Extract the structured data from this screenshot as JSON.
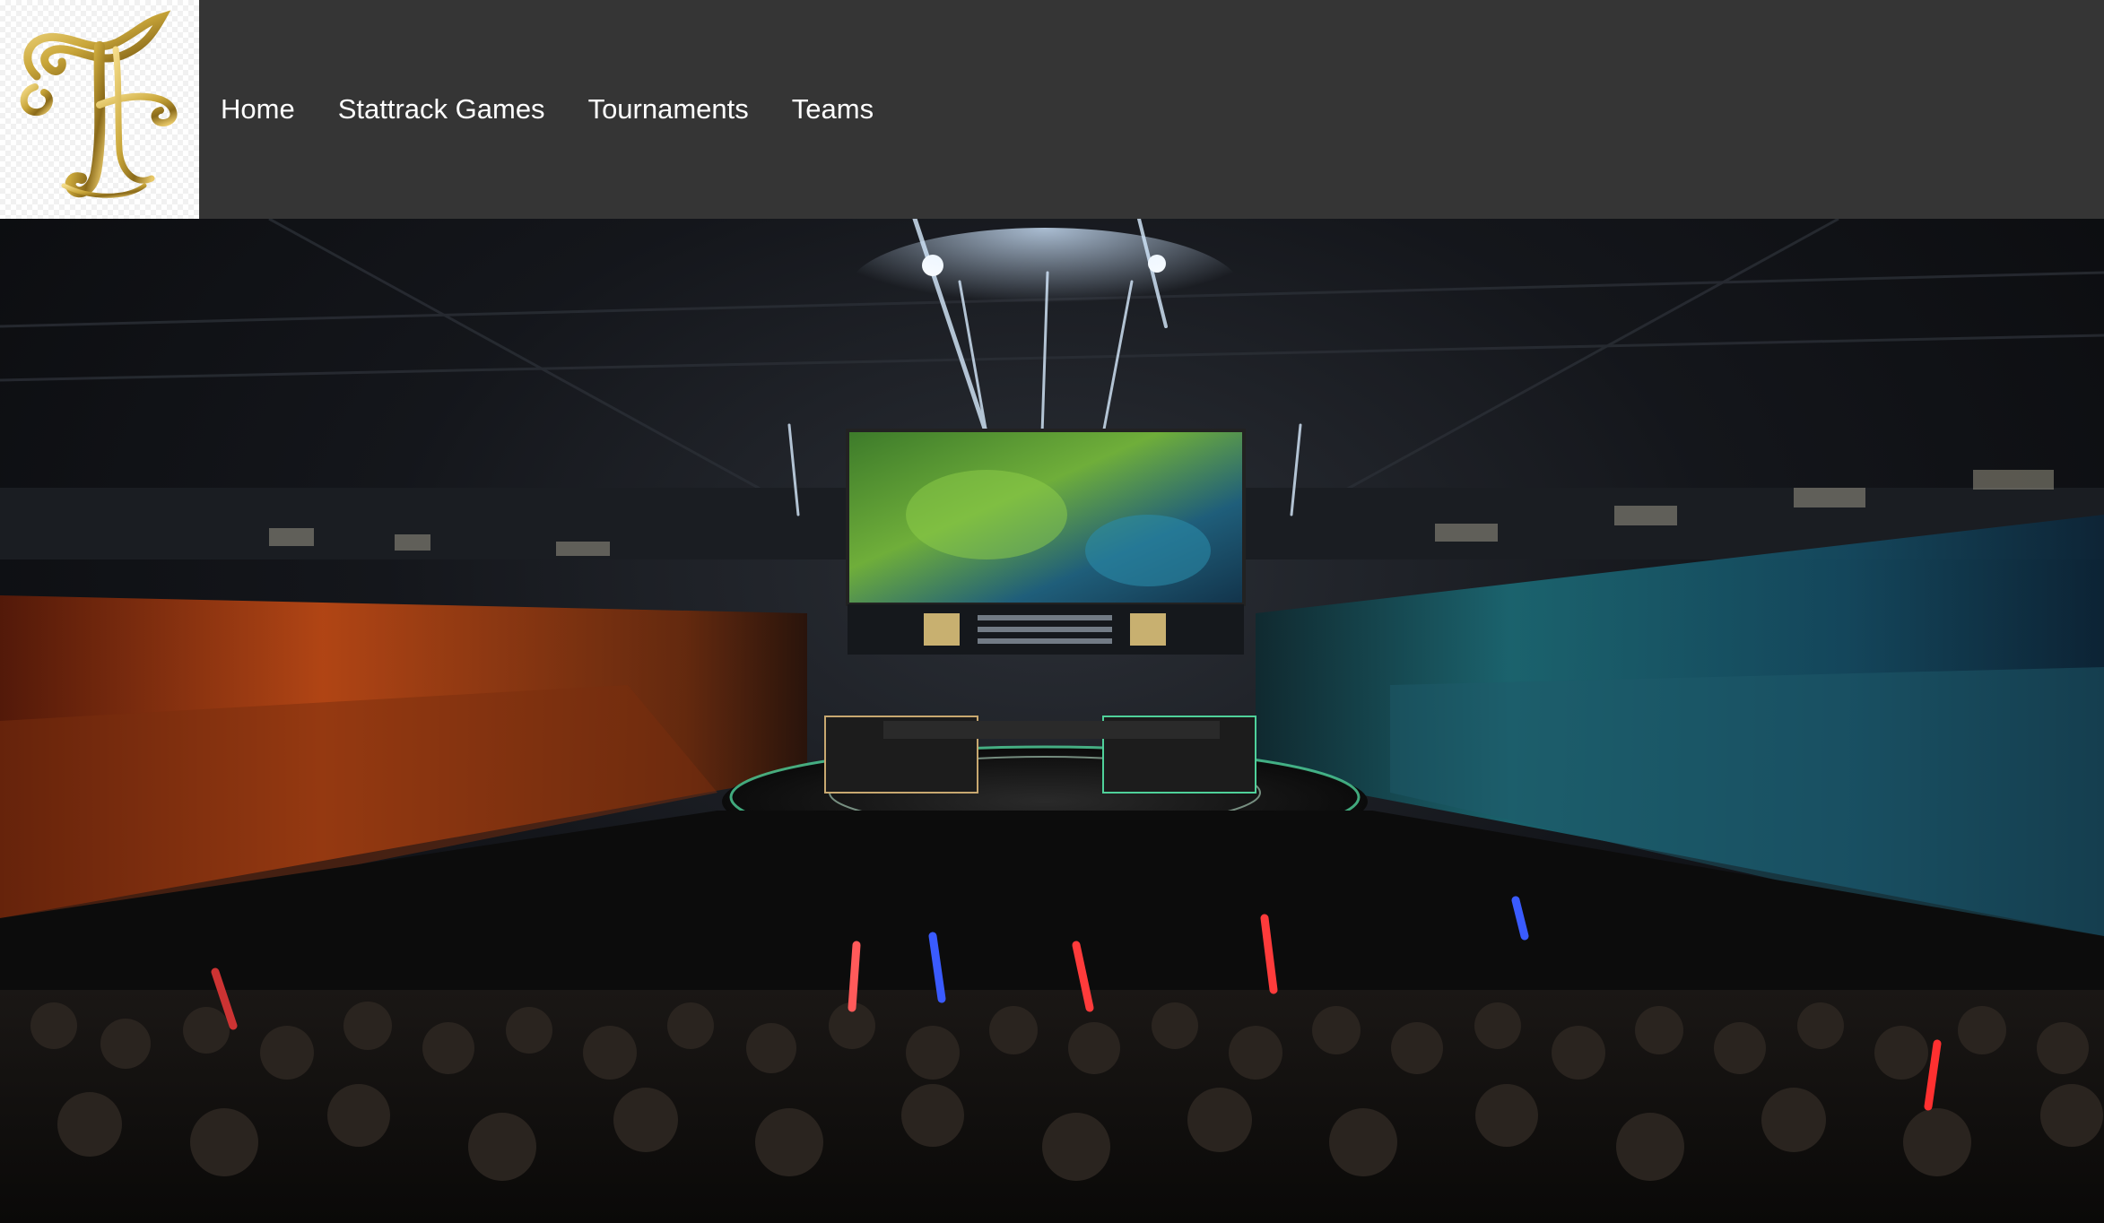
{
  "site": {
    "logo": {
      "letters": "TF",
      "icon": "ornate-gold-monogram",
      "color": "#c9a63a"
    }
  },
  "nav": {
    "items": [
      {
        "label": "Home"
      },
      {
        "label": "Stattrack Games"
      },
      {
        "label": "Tournaments"
      },
      {
        "label": "Teams"
      }
    ]
  },
  "hero": {
    "image": "esports-arena-finals-stage",
    "colors": {
      "left_crowd": "#d2561c",
      "right_crowd": "#1e7f8c",
      "stage_ring": "#4fd19a"
    }
  }
}
